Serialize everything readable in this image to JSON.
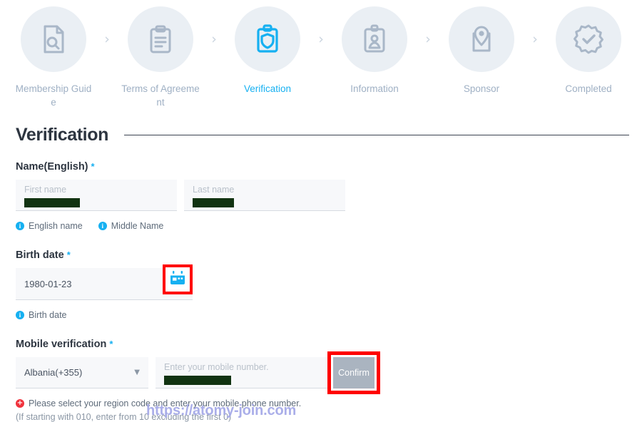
{
  "stepper": {
    "separator": "›",
    "steps": [
      {
        "label": "Membership Guide",
        "icon": "document-search-icon",
        "active": false
      },
      {
        "label": "Terms of Agreement",
        "icon": "clipboard-lines-icon",
        "active": false
      },
      {
        "label": "Verification",
        "icon": "clipboard-shield-icon",
        "active": true
      },
      {
        "label": "Information",
        "icon": "id-card-icon",
        "active": false
      },
      {
        "label": "Sponsor",
        "icon": "map-pin-icon",
        "active": false
      },
      {
        "label": "Completed",
        "icon": "badge-check-icon",
        "active": false
      }
    ]
  },
  "section": {
    "title": "Verification"
  },
  "name_field": {
    "label": "Name(English)",
    "required_mark": "*",
    "first_placeholder": "First name",
    "last_placeholder": "Last name",
    "first_value": "",
    "last_value": "",
    "hints": [
      {
        "icon": "info-icon",
        "text": "English name"
      },
      {
        "icon": "info-icon",
        "text": "Middle Name"
      }
    ]
  },
  "birth_field": {
    "label": "Birth date",
    "required_mark": "*",
    "value": "1980-01-23",
    "calendar_icon": "calendar-icon",
    "hint": {
      "icon": "info-icon",
      "text": "Birth date"
    }
  },
  "mobile_field": {
    "label": "Mobile verification",
    "required_mark": "*",
    "country_value": "Albania(+355)",
    "caret": "▼",
    "number_placeholder": "Enter your mobile number.",
    "number_value": "",
    "confirm_label": "Confirm",
    "error_icon": "error-plus-icon",
    "error_line1": "Please select your region code and enter your mobile phone number.",
    "error_line2": "(If starting with 010, enter from 10 excluding the first 0)"
  },
  "watermark": {
    "text": "https://atomy-join.com"
  },
  "colors": {
    "accent": "#16b0f1",
    "muted": "#9fb0c4",
    "circle_bg": "#eaeff4",
    "highlight": "#ff0000",
    "error": "#f0323c",
    "redaction": "#113311",
    "watermark": "#a3a8e8"
  }
}
